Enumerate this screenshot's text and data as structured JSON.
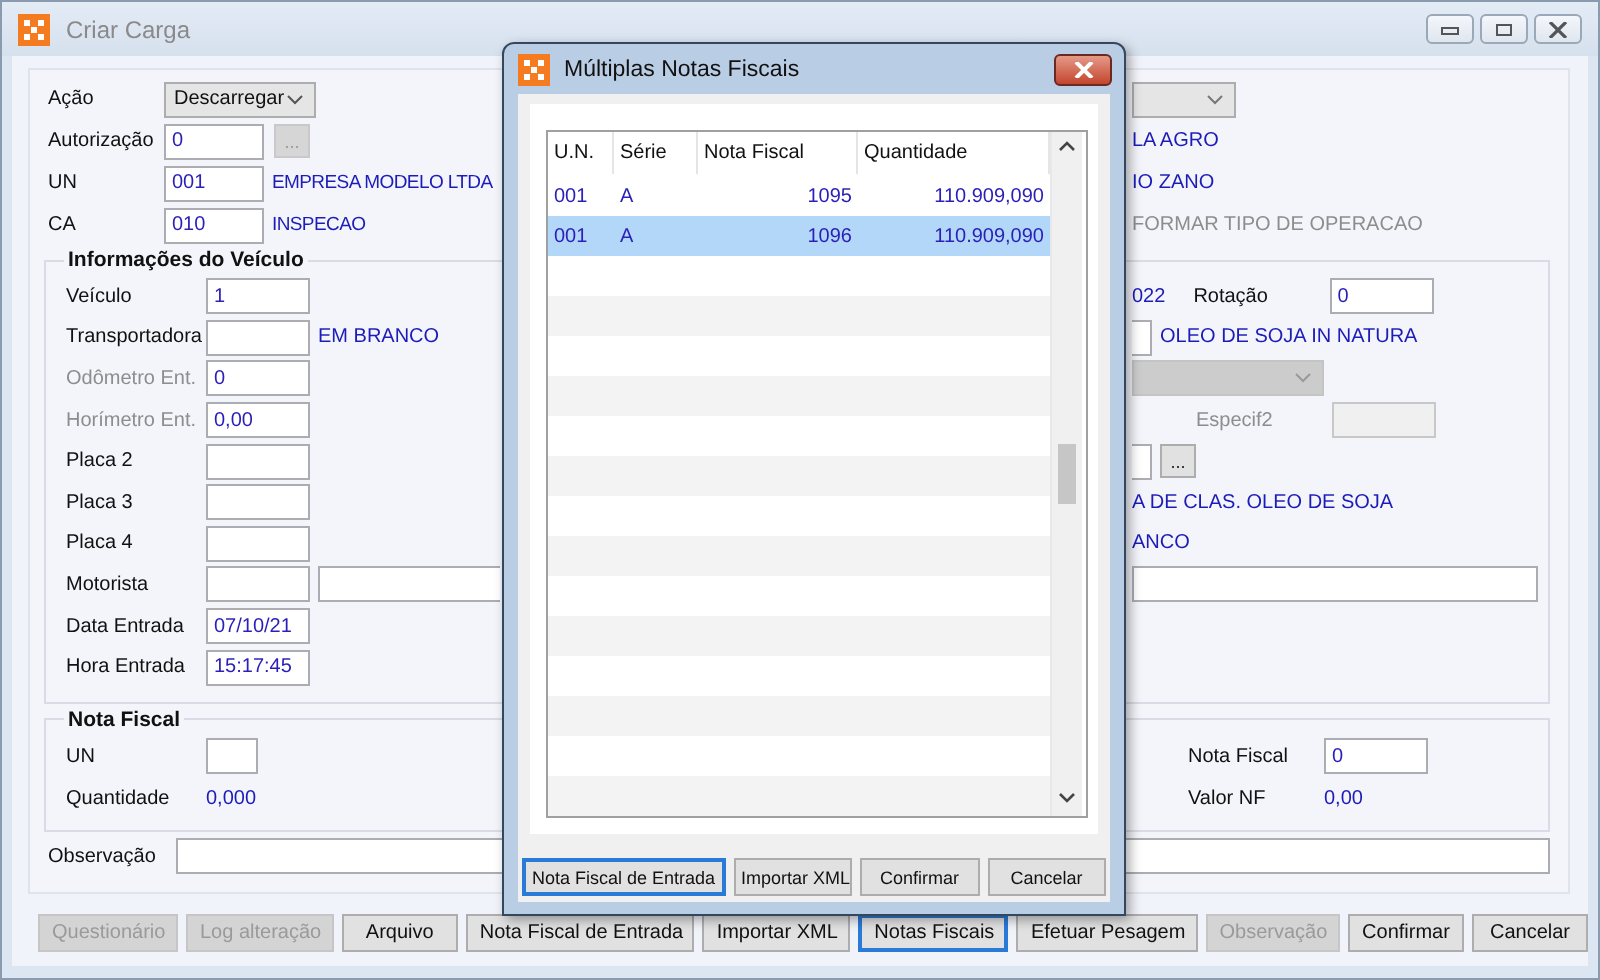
{
  "window": {
    "title": "Criar Carga"
  },
  "header_fields": [
    {
      "label": "Ação",
      "kind": "dropdown",
      "value": "Descarregar"
    },
    {
      "label": "Autorização",
      "kind": "lookup",
      "value": "0",
      "button": {
        "text": "...",
        "disabled": true
      }
    },
    {
      "label": "UN",
      "kind": "field",
      "value": "001",
      "description": "EMPRESA MODELO LTDA"
    },
    {
      "label": "CA",
      "kind": "field",
      "value": "010",
      "description": "INSPECAO"
    }
  ],
  "header_right": [
    {
      "kind": "dropdown",
      "disabled": false
    },
    {
      "kind": "text",
      "text": "LA AGRO",
      "disabled": false
    },
    {
      "kind": "text",
      "text": "IO ZANO",
      "disabled": false
    },
    {
      "kind": "text",
      "text": "FORMAR TIPO DE OPERACAO",
      "disabled": true
    }
  ],
  "vehicle": {
    "title": "Informações do Veículo",
    "fields": [
      {
        "label": "Veículo",
        "kind": "field",
        "value": "1",
        "disabled": false
      },
      {
        "label": "Transportadora",
        "kind": "field",
        "description": "EM BRANCO",
        "disabled": false
      },
      {
        "label": "Odômetro Ent.",
        "kind": "field",
        "value": "0",
        "disabled": true
      },
      {
        "label": "Horímetro Ent.",
        "kind": "field",
        "value": "0,00",
        "disabled": true
      },
      {
        "label": "Placa 2",
        "kind": "field",
        "disabled": false
      },
      {
        "label": "Placa 3",
        "kind": "field",
        "disabled": false
      },
      {
        "label": "Placa 4",
        "kind": "field",
        "disabled": false
      },
      {
        "label": "Motorista",
        "kind": "double_field",
        "disabled": false
      },
      {
        "label": "Data Entrada",
        "kind": "field",
        "value": "07/10/21",
        "disabled": false
      },
      {
        "label": "Hora Entrada",
        "kind": "field",
        "value": "15:17:45",
        "disabled": false
      }
    ],
    "right_rows": [
      [
        {
          "kind": "text",
          "text": "022"
        },
        {
          "kind": "label",
          "text": "Rotação",
          "disabled": false
        },
        {
          "kind": "field",
          "value": "0",
          "disabled": false
        }
      ],
      [
        {
          "kind": "field_edge"
        },
        {
          "kind": "text",
          "text": "OLEO DE SOJA IN NATURA"
        }
      ],
      [
        {
          "kind": "dropdown",
          "disabled": true
        }
      ],
      [
        {
          "kind": "label",
          "text": "Especif2",
          "disabled": true
        },
        {
          "kind": "field",
          "disabled": true
        }
      ],
      [
        {
          "kind": "field_edge"
        },
        {
          "kind": "button",
          "text": "...",
          "disabled": false
        }
      ],
      [
        {
          "kind": "text",
          "text": "A DE CLAS. OLEO DE SOJA"
        }
      ],
      [
        {
          "kind": "text",
          "text": "ANCO"
        }
      ],
      [
        {
          "kind": "wide_field"
        }
      ]
    ]
  },
  "nota_fiscal": {
    "title": "Nota Fiscal",
    "left": [
      {
        "label": "UN",
        "kind": "field"
      },
      {
        "label": "Quantidade",
        "kind": "value",
        "value": "0,000"
      }
    ],
    "right": [
      {
        "label": "Nota Fiscal",
        "kind": "field",
        "value": "0"
      },
      {
        "label": "Valor NF",
        "kind": "value",
        "value": "0,00"
      }
    ]
  },
  "observation": {
    "label": "Observação"
  },
  "buttons": [
    {
      "label": "Questionário",
      "disabled": true,
      "focused": false
    },
    {
      "label": "Log alteração",
      "disabled": true,
      "focused": false
    },
    {
      "label": "Arquivo",
      "disabled": false,
      "focused": false
    },
    {
      "label": "Nota Fiscal de Entrada",
      "disabled": false,
      "focused": false
    },
    {
      "label": "Importar XML",
      "disabled": false,
      "focused": false
    },
    {
      "label": "Notas Fiscais",
      "disabled": false,
      "focused": true
    },
    {
      "label": "Efetuar Pesagem",
      "disabled": false,
      "focused": false
    },
    {
      "label": "Observação",
      "disabled": true,
      "focused": false
    },
    {
      "label": "Confirmar",
      "disabled": false,
      "focused": false
    },
    {
      "label": "Cancelar",
      "disabled": false,
      "focused": false
    }
  ],
  "modal": {
    "title": "Múltiplas Notas Fiscais",
    "columns": [
      "U.N.",
      "Série",
      "Nota Fiscal",
      "Quantidade"
    ],
    "rows": [
      {
        "un": "001",
        "serie": "A",
        "nota_fiscal": "1095",
        "quantidade": "110.909,090",
        "selected": false
      },
      {
        "un": "001",
        "serie": "A",
        "nota_fiscal": "1096",
        "quantidade": "110.909,090",
        "selected": true
      }
    ],
    "buttons": [
      {
        "label": "Nota Fiscal de Entrada",
        "focused": true
      },
      {
        "label": "Importar XML",
        "focused": false
      },
      {
        "label": "Confirmar",
        "focused": false
      },
      {
        "label": "Cancelar",
        "focused": false
      }
    ]
  }
}
